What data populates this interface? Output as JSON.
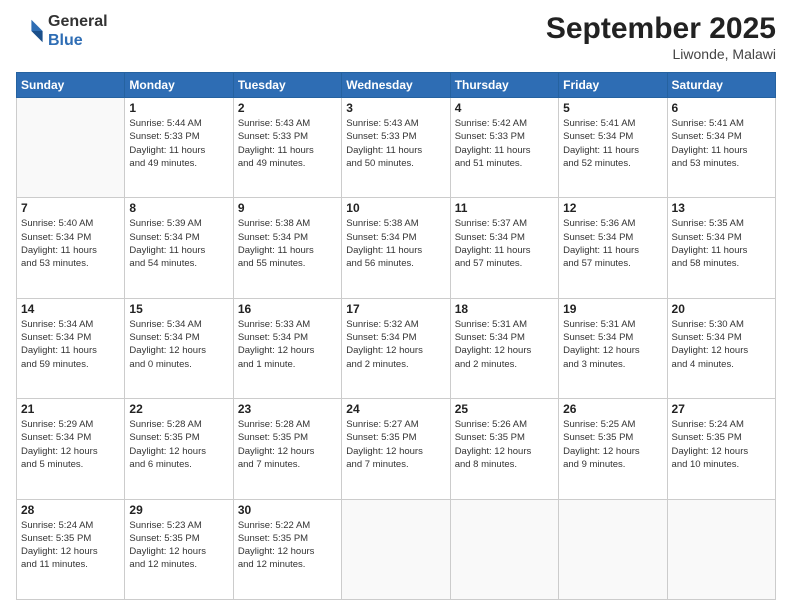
{
  "header": {
    "logo": {
      "line1": "General",
      "line2": "Blue"
    },
    "title": "September 2025",
    "location": "Liwonde, Malawi"
  },
  "weekdays": [
    "Sunday",
    "Monday",
    "Tuesday",
    "Wednesday",
    "Thursday",
    "Friday",
    "Saturday"
  ],
  "weeks": [
    [
      {
        "day": "",
        "info": ""
      },
      {
        "day": "1",
        "info": "Sunrise: 5:44 AM\nSunset: 5:33 PM\nDaylight: 11 hours\nand 49 minutes."
      },
      {
        "day": "2",
        "info": "Sunrise: 5:43 AM\nSunset: 5:33 PM\nDaylight: 11 hours\nand 49 minutes."
      },
      {
        "day": "3",
        "info": "Sunrise: 5:43 AM\nSunset: 5:33 PM\nDaylight: 11 hours\nand 50 minutes."
      },
      {
        "day": "4",
        "info": "Sunrise: 5:42 AM\nSunset: 5:33 PM\nDaylight: 11 hours\nand 51 minutes."
      },
      {
        "day": "5",
        "info": "Sunrise: 5:41 AM\nSunset: 5:34 PM\nDaylight: 11 hours\nand 52 minutes."
      },
      {
        "day": "6",
        "info": "Sunrise: 5:41 AM\nSunset: 5:34 PM\nDaylight: 11 hours\nand 53 minutes."
      }
    ],
    [
      {
        "day": "7",
        "info": "Sunrise: 5:40 AM\nSunset: 5:34 PM\nDaylight: 11 hours\nand 53 minutes."
      },
      {
        "day": "8",
        "info": "Sunrise: 5:39 AM\nSunset: 5:34 PM\nDaylight: 11 hours\nand 54 minutes."
      },
      {
        "day": "9",
        "info": "Sunrise: 5:38 AM\nSunset: 5:34 PM\nDaylight: 11 hours\nand 55 minutes."
      },
      {
        "day": "10",
        "info": "Sunrise: 5:38 AM\nSunset: 5:34 PM\nDaylight: 11 hours\nand 56 minutes."
      },
      {
        "day": "11",
        "info": "Sunrise: 5:37 AM\nSunset: 5:34 PM\nDaylight: 11 hours\nand 57 minutes."
      },
      {
        "day": "12",
        "info": "Sunrise: 5:36 AM\nSunset: 5:34 PM\nDaylight: 11 hours\nand 57 minutes."
      },
      {
        "day": "13",
        "info": "Sunrise: 5:35 AM\nSunset: 5:34 PM\nDaylight: 11 hours\nand 58 minutes."
      }
    ],
    [
      {
        "day": "14",
        "info": "Sunrise: 5:34 AM\nSunset: 5:34 PM\nDaylight: 11 hours\nand 59 minutes."
      },
      {
        "day": "15",
        "info": "Sunrise: 5:34 AM\nSunset: 5:34 PM\nDaylight: 12 hours\nand 0 minutes."
      },
      {
        "day": "16",
        "info": "Sunrise: 5:33 AM\nSunset: 5:34 PM\nDaylight: 12 hours\nand 1 minute."
      },
      {
        "day": "17",
        "info": "Sunrise: 5:32 AM\nSunset: 5:34 PM\nDaylight: 12 hours\nand 2 minutes."
      },
      {
        "day": "18",
        "info": "Sunrise: 5:31 AM\nSunset: 5:34 PM\nDaylight: 12 hours\nand 2 minutes."
      },
      {
        "day": "19",
        "info": "Sunrise: 5:31 AM\nSunset: 5:34 PM\nDaylight: 12 hours\nand 3 minutes."
      },
      {
        "day": "20",
        "info": "Sunrise: 5:30 AM\nSunset: 5:34 PM\nDaylight: 12 hours\nand 4 minutes."
      }
    ],
    [
      {
        "day": "21",
        "info": "Sunrise: 5:29 AM\nSunset: 5:34 PM\nDaylight: 12 hours\nand 5 minutes."
      },
      {
        "day": "22",
        "info": "Sunrise: 5:28 AM\nSunset: 5:35 PM\nDaylight: 12 hours\nand 6 minutes."
      },
      {
        "day": "23",
        "info": "Sunrise: 5:28 AM\nSunset: 5:35 PM\nDaylight: 12 hours\nand 7 minutes."
      },
      {
        "day": "24",
        "info": "Sunrise: 5:27 AM\nSunset: 5:35 PM\nDaylight: 12 hours\nand 7 minutes."
      },
      {
        "day": "25",
        "info": "Sunrise: 5:26 AM\nSunset: 5:35 PM\nDaylight: 12 hours\nand 8 minutes."
      },
      {
        "day": "26",
        "info": "Sunrise: 5:25 AM\nSunset: 5:35 PM\nDaylight: 12 hours\nand 9 minutes."
      },
      {
        "day": "27",
        "info": "Sunrise: 5:24 AM\nSunset: 5:35 PM\nDaylight: 12 hours\nand 10 minutes."
      }
    ],
    [
      {
        "day": "28",
        "info": "Sunrise: 5:24 AM\nSunset: 5:35 PM\nDaylight: 12 hours\nand 11 minutes."
      },
      {
        "day": "29",
        "info": "Sunrise: 5:23 AM\nSunset: 5:35 PM\nDaylight: 12 hours\nand 12 minutes."
      },
      {
        "day": "30",
        "info": "Sunrise: 5:22 AM\nSunset: 5:35 PM\nDaylight: 12 hours\nand 12 minutes."
      },
      {
        "day": "",
        "info": ""
      },
      {
        "day": "",
        "info": ""
      },
      {
        "day": "",
        "info": ""
      },
      {
        "day": "",
        "info": ""
      }
    ]
  ]
}
